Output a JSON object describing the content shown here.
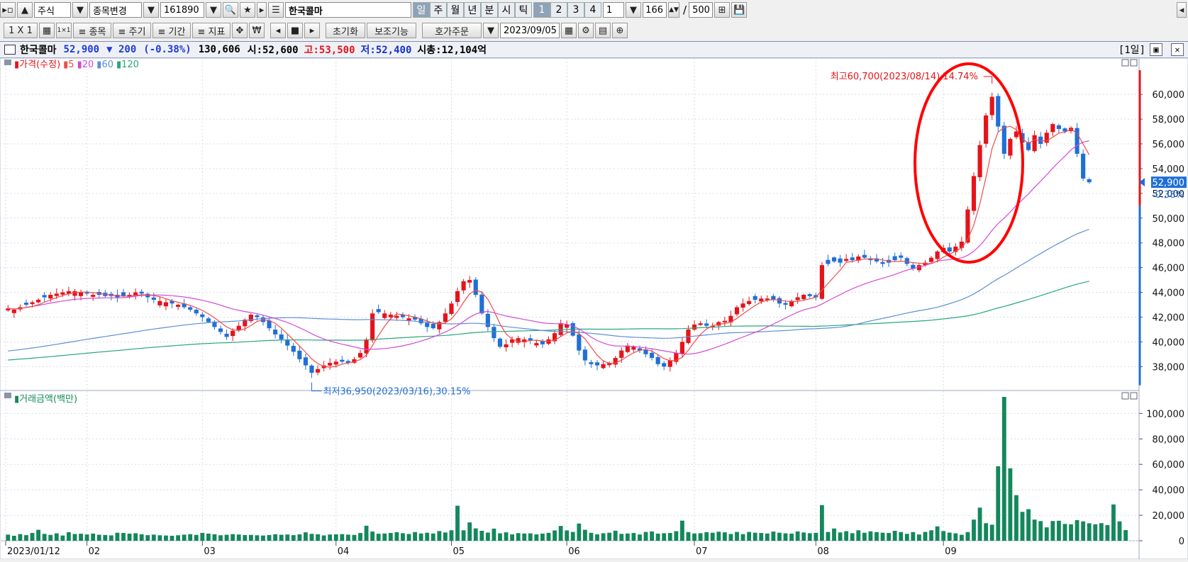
{
  "toolbar1": {
    "market": "주식",
    "code_change": "종목변경",
    "code": "161890",
    "stock_name": "한국콜마",
    "periods": [
      "일",
      "주",
      "월",
      "년",
      "분",
      "시",
      "틱"
    ],
    "selected_period": "일",
    "numbers": [
      "1",
      "2",
      "3",
      "4"
    ],
    "interval": "1",
    "count": "166",
    "total": "500"
  },
  "toolbar2": {
    "layout": "1 X 1",
    "btn_item": "≡ 종목",
    "btn_cycle": "≡ 주기",
    "btn_period": "≡ 기간",
    "btn_index": "≡ 지표",
    "won": "₩",
    "reset": "초기화",
    "aux": "보조기능",
    "order": "호가주문",
    "date": "2023/09/05"
  },
  "info": {
    "name": "한국콜마",
    "price": "52,900",
    "change": "▼ 200",
    "change_pct": "(-0.38%)",
    "volume": "130,606",
    "open_label": "시:",
    "open": "52,600",
    "high_label": "고:",
    "high": "53,500",
    "low_label": "저:",
    "low": "52,400",
    "cap_label": "시총:",
    "cap": "12,104억",
    "period_tag": "[1일]"
  },
  "colors": {
    "up": "#e4141a",
    "down": "#1f6fd8",
    "ma5": "#ef4b4b",
    "ma20": "#d34ad8",
    "ma60": "#5c8fd6",
    "ma120": "#2aa67d",
    "volume": "#13885c",
    "circle": "#ff0000"
  },
  "chart_data": [
    {
      "type": "candlestick",
      "legend": {
        "title": "가격(수정)",
        "items": [
          "5",
          "20",
          "60",
          "120"
        ]
      },
      "y_ticks": [
        "60,000",
        "58,000",
        "56,000",
        "54,000",
        "52,000",
        "50,000",
        "48,000",
        "46,000",
        "44,000",
        "42,000",
        "40,000",
        "38,000"
      ],
      "ylim": [
        36700,
        61900
      ],
      "current_price": "52,900",
      "current_pct": "-0.38%",
      "annotation_high": "최고60,700(2023/08/14),14.74%",
      "annotation_low": "최저36,950(2023/03/16),30.15%",
      "x_labels": [
        "2023/01/12",
        "02",
        "03",
        "04",
        "05",
        "06",
        "07",
        "08",
        "09"
      ],
      "closes": [
        42700,
        42600,
        42800,
        43000,
        43200,
        43400,
        43600,
        43800,
        43900,
        44000,
        44100,
        44100,
        44000,
        43900,
        43800,
        43800,
        43700,
        43700,
        43600,
        43700,
        43800,
        44000,
        43900,
        43600,
        43400,
        43300,
        43200,
        43100,
        43000,
        42800,
        42600,
        42300,
        42000,
        41600,
        41200,
        40800,
        40400,
        40900,
        41300,
        41800,
        42200,
        42000,
        41600,
        41100,
        40600,
        40200,
        39700,
        39200,
        38600,
        38100,
        37500,
        37800,
        38100,
        38300,
        38400,
        38400,
        38300,
        38600,
        39100,
        40200,
        42300,
        42400,
        42300,
        42200,
        42100,
        42000,
        41900,
        41800,
        41500,
        41200,
        41100,
        41600,
        42300,
        43100,
        44100,
        44900,
        45000,
        43800,
        42300,
        41200,
        40300,
        39600,
        39800,
        40200,
        40300,
        40200,
        40100,
        39900,
        39800,
        40200,
        40700,
        41500,
        41400,
        40500,
        39300,
        38500,
        38200,
        38100,
        38200,
        38300,
        38700,
        39300,
        39700,
        39600,
        39300,
        39000,
        38700,
        38200,
        38000,
        38500,
        39100,
        40000,
        41000,
        41400,
        41500,
        41300,
        41300,
        41600,
        41700,
        42100,
        42800,
        43100,
        43300,
        43400,
        43500,
        43500,
        43400,
        43100,
        43000,
        43300,
        43600,
        43800,
        43700,
        43600,
        46200,
        46300,
        46500,
        46400,
        46700,
        46600,
        46900,
        46800,
        46600,
        46500,
        46300,
        46400,
        46600,
        46800,
        46300,
        45900,
        46200,
        46400,
        46800,
        47300,
        47600,
        47300,
        47700,
        48100,
        50700,
        53400,
        55900,
        58300,
        59800,
        57400,
        55200,
        56400,
        57000,
        56100,
        55500,
        56700,
        56000,
        56900,
        57600,
        57200,
        57000,
        57300,
        55200,
        53200,
        52900
      ],
      "ma60_start": 39200,
      "ma120_start": 38500
    },
    {
      "type": "bar",
      "legend": {
        "title": "거래금액(백만)"
      },
      "y_ticks": [
        "100,000",
        "80,000",
        "60,000",
        "40,000",
        "20,000",
        "0"
      ],
      "ylim": [
        0,
        113000
      ],
      "values": [
        4800,
        3900,
        5200,
        4400,
        6100,
        8600,
        5400,
        4600,
        5800,
        4100,
        6700,
        5300,
        5500,
        4900,
        5600,
        4700,
        4500,
        4200,
        6300,
        6100,
        5600,
        5900,
        5100,
        4400,
        4800,
        4300,
        4100,
        3900,
        4300,
        4800,
        5200,
        4600,
        6200,
        5600,
        5100,
        4300,
        4700,
        5200,
        4900,
        4500,
        4600,
        4300,
        4100,
        4500,
        5100,
        4700,
        4900,
        4400,
        5000,
        6600,
        5400,
        5100,
        4200,
        4900,
        5000,
        5200,
        4800,
        4600,
        6100,
        11800,
        7200,
        5500,
        5700,
        6100,
        6700,
        5900,
        5300,
        6800,
        5700,
        6300,
        5700,
        7600,
        6500,
        8200,
        27500,
        8200,
        14400,
        9700,
        7800,
        6400,
        9500,
        5800,
        6600,
        5000,
        6000,
        5700,
        5800,
        5000,
        5600,
        6200,
        8100,
        11600,
        8100,
        6900,
        13500,
        8600,
        6200,
        5000,
        5900,
        6300,
        7900,
        5400,
        5700,
        6100,
        4900,
        6900,
        7300,
        5600,
        5900,
        6100,
        7500,
        15800,
        6800,
        5700,
        5900,
        6700,
        6300,
        7100,
        6600,
        5300,
        6900,
        5200,
        6900,
        6300,
        6100,
        5700,
        7200,
        6300,
        5800,
        5600,
        7300,
        6500,
        5900,
        6200,
        28000,
        6900,
        9600,
        6500,
        7500,
        5900,
        8200,
        6300,
        7400,
        6800,
        6300,
        6100,
        7800,
        6800,
        5400,
        6800,
        4900,
        6900,
        8200,
        11300,
        7600,
        6400,
        5800,
        4700,
        6800,
        16600,
        26000,
        13800,
        12600,
        58500,
        113000,
        56900,
        35800,
        22700,
        24800,
        16600,
        15400,
        10500,
        15500,
        15700,
        13200,
        12900,
        16200,
        15200,
        13700,
        12900,
        13800,
        12300,
        28500,
        15200,
        8400
      ]
    }
  ]
}
